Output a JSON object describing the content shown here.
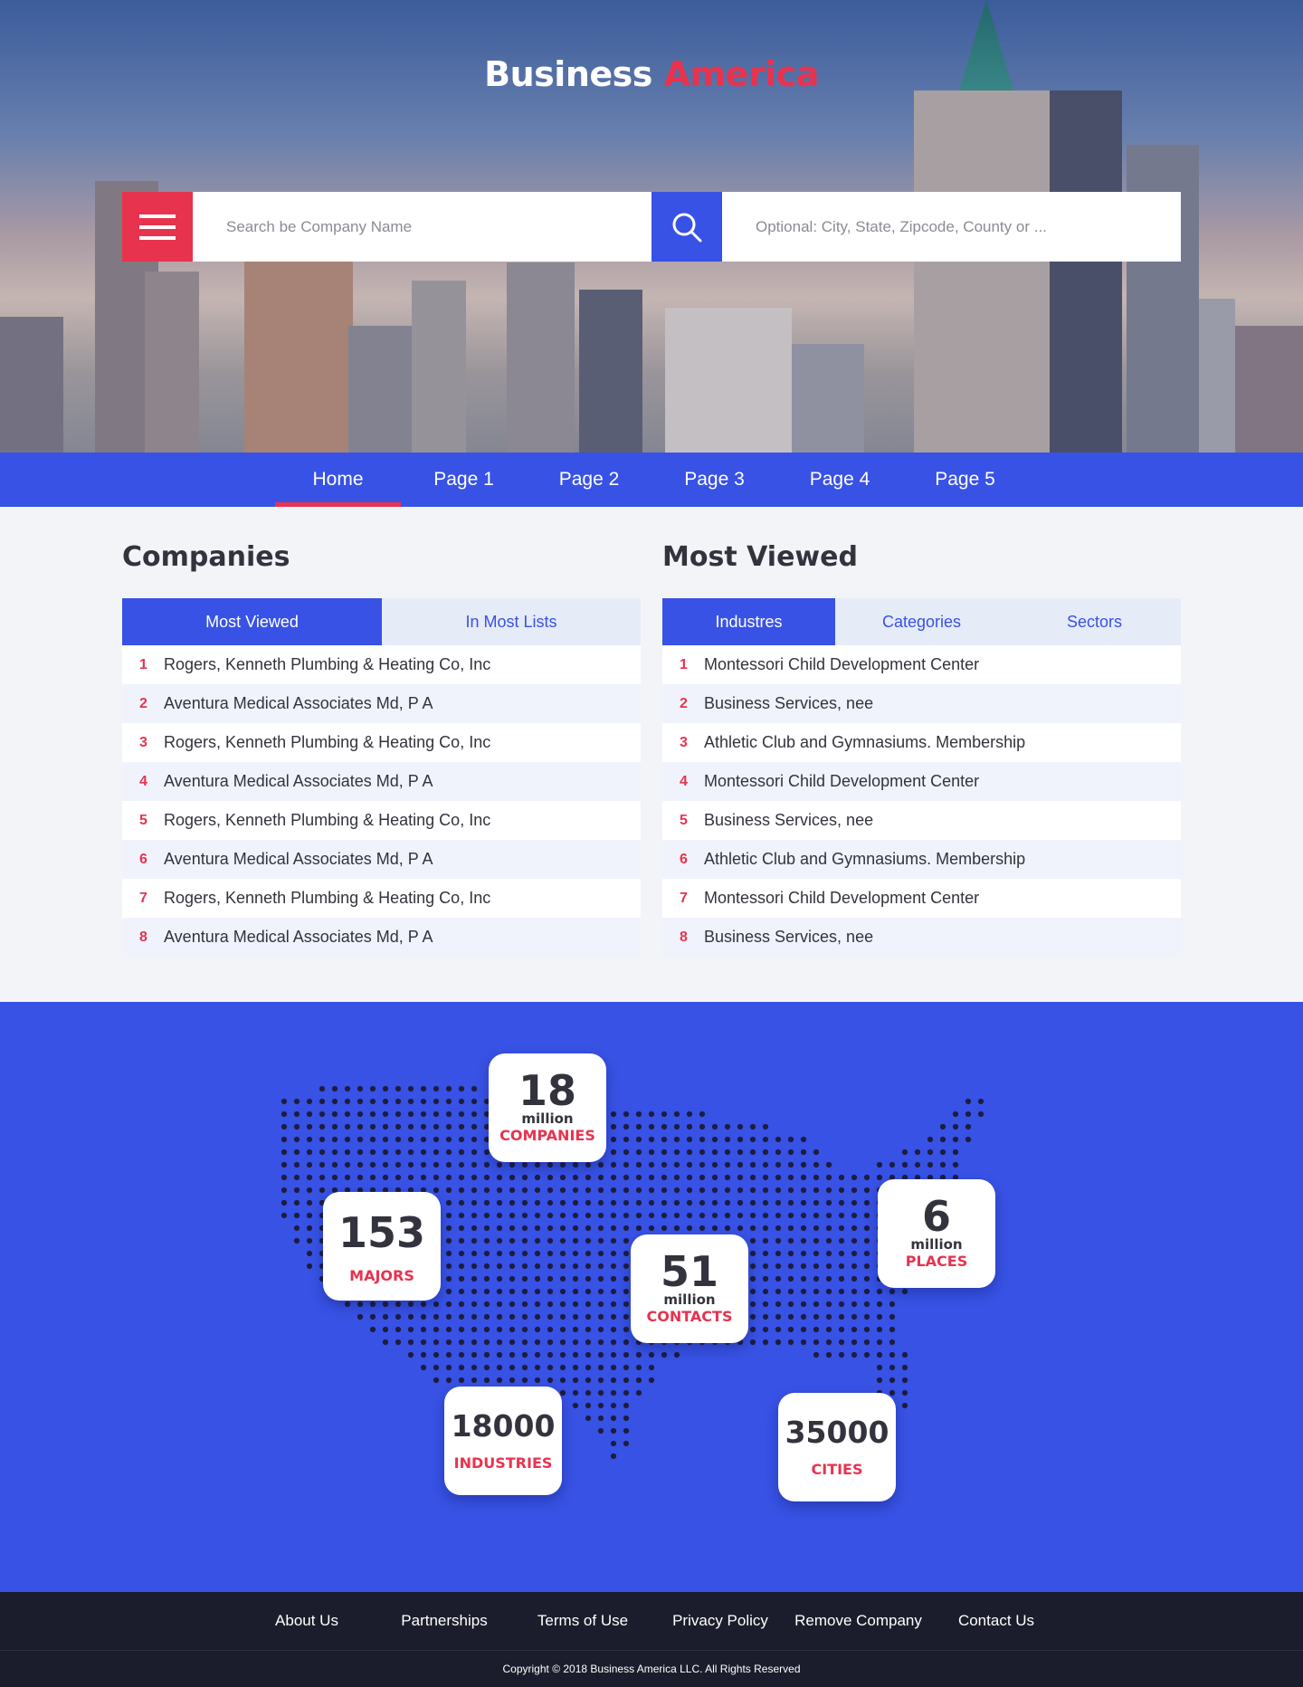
{
  "brand": {
    "name_part1": "Business",
    "name_part2": "America"
  },
  "search": {
    "company_placeholder": "Search be Company Name",
    "location_placeholder": "Optional: City, State, Zipcode, County or ..."
  },
  "nav": {
    "items": [
      "Home",
      "Page 1",
      "Page 2",
      "Page 3",
      "Page 4",
      "Page 5"
    ],
    "active": "Home"
  },
  "companies": {
    "title": "Companies",
    "tabs": [
      "Most Viewed",
      "In Most Lists"
    ],
    "active_tab": "Most Viewed",
    "rows": [
      {
        "rank": "1",
        "name": "Rogers, Kenneth Plumbing & Heating Co, Inc"
      },
      {
        "rank": "2",
        "name": "Aventura Medical Associates Md, P A"
      },
      {
        "rank": "3",
        "name": "Rogers, Kenneth Plumbing & Heating Co, Inc"
      },
      {
        "rank": "4",
        "name": "Aventura Medical Associates Md, P A"
      },
      {
        "rank": "5",
        "name": "Rogers, Kenneth Plumbing & Heating Co, Inc"
      },
      {
        "rank": "6",
        "name": "Aventura Medical Associates Md, P A"
      },
      {
        "rank": "7",
        "name": "Rogers, Kenneth Plumbing & Heating Co, Inc"
      },
      {
        "rank": "8",
        "name": "Aventura Medical Associates Md, P A"
      }
    ]
  },
  "most_viewed": {
    "title": "Most Viewed",
    "tabs": [
      "Industres",
      "Categories",
      "Sectors"
    ],
    "active_tab": "Industres",
    "rows": [
      {
        "rank": "1",
        "name": "Montessori Child Development Center"
      },
      {
        "rank": "2",
        "name": "Business Services, nee"
      },
      {
        "rank": "3",
        "name": "Athletic Club and Gymnasiums. Membership"
      },
      {
        "rank": "4",
        "name": "Montessori Child Development Center"
      },
      {
        "rank": "5",
        "name": "Business Services, nee"
      },
      {
        "rank": "6",
        "name": "Athletic Club and Gymnasiums. Membership"
      },
      {
        "rank": "7",
        "name": "Montessori Child Development Center"
      },
      {
        "rank": "8",
        "name": "Business Services, nee"
      }
    ]
  },
  "stats": {
    "companies": {
      "value": "18",
      "unit": "million",
      "label": "COMPANIES"
    },
    "majors": {
      "value": "153",
      "unit": "",
      "label": "MAJORS"
    },
    "contacts": {
      "value": "51",
      "unit": "million",
      "label": "CONTACTS"
    },
    "places": {
      "value": "6",
      "unit": "million",
      "label": "PLACES"
    },
    "industries": {
      "value": "18000",
      "unit": "",
      "label": "INDUSTRIES"
    },
    "cities": {
      "value": "35000",
      "unit": "",
      "label": "CITIES"
    }
  },
  "footer": {
    "links": [
      "About Us",
      "Partnerships",
      "Terms of Use",
      "Privacy Policy",
      "Remove Company",
      "Contact Us"
    ],
    "copyright": "Copyright © 2018 Business America LLC. All Rights Reserved"
  },
  "colors": {
    "primary": "#3852e5",
    "accent": "#e8334f",
    "dark": "#1c1d2c",
    "text": "#33333d"
  },
  "icons": {
    "menu": "hamburger-menu-icon",
    "search": "search-icon",
    "map": "usa-dot-map"
  }
}
